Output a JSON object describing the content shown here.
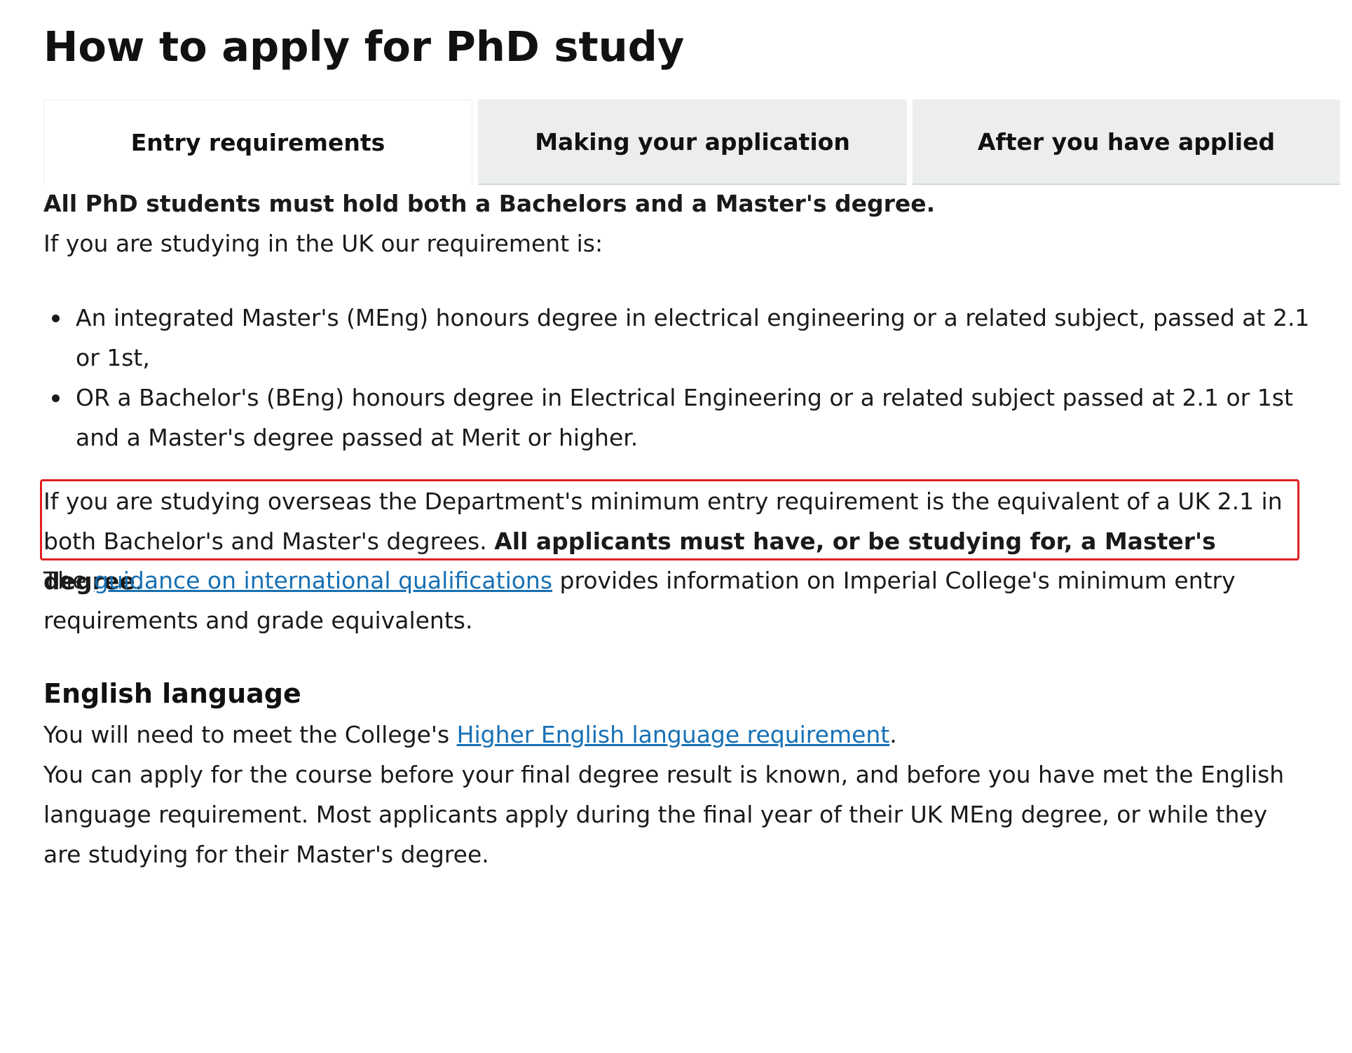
{
  "page": {
    "title": "How to apply for PhD study"
  },
  "tabs": [
    {
      "label": "Entry requirements",
      "active": true
    },
    {
      "label": "Making your application",
      "active": false
    },
    {
      "label": "After you have applied",
      "active": false
    }
  ],
  "content": {
    "lead": "All PhD students must hold both a Bachelors and a Master's degree.",
    "uk_intro": "If you are studying in the UK our requirement is:",
    "uk_requirements": [
      "An integrated Master's (MEng) honours degree in electrical engineering or a related subject, passed at 2.1 or 1st,",
      "OR a Bachelor's (BEng) honours degree in Electrical Engineering or a related subject passed at 2.1 or 1st and a Master's degree passed at Merit or higher."
    ],
    "overseas": {
      "text": "If you are studying overseas the Department's minimum entry requirement is the equivalent of a UK 2.1 in both Bachelor's and Master's degrees. ",
      "bold": "All applicants must have, or be studying for, a Master's degree",
      "end": "."
    },
    "guidance": {
      "before": "The ",
      "link": "guidance on international qualifications",
      "after": " provides information on Imperial College's minimum entry requirements and grade equivalents."
    },
    "english_heading": "English language",
    "english_req": {
      "before": "You will need to meet the College's ",
      "link": "Higher English language requirement",
      "after": "."
    },
    "apply_before": "You can apply for the course before your final degree result is known, and before you have met the English language requirement. Most applicants apply during the final year of their UK MEng degree, or while they are studying for their Master's degree."
  },
  "colors": {
    "link": "#1770b4",
    "highlight_border": "#e02020",
    "inactive_tab_bg": "#ebedee"
  }
}
